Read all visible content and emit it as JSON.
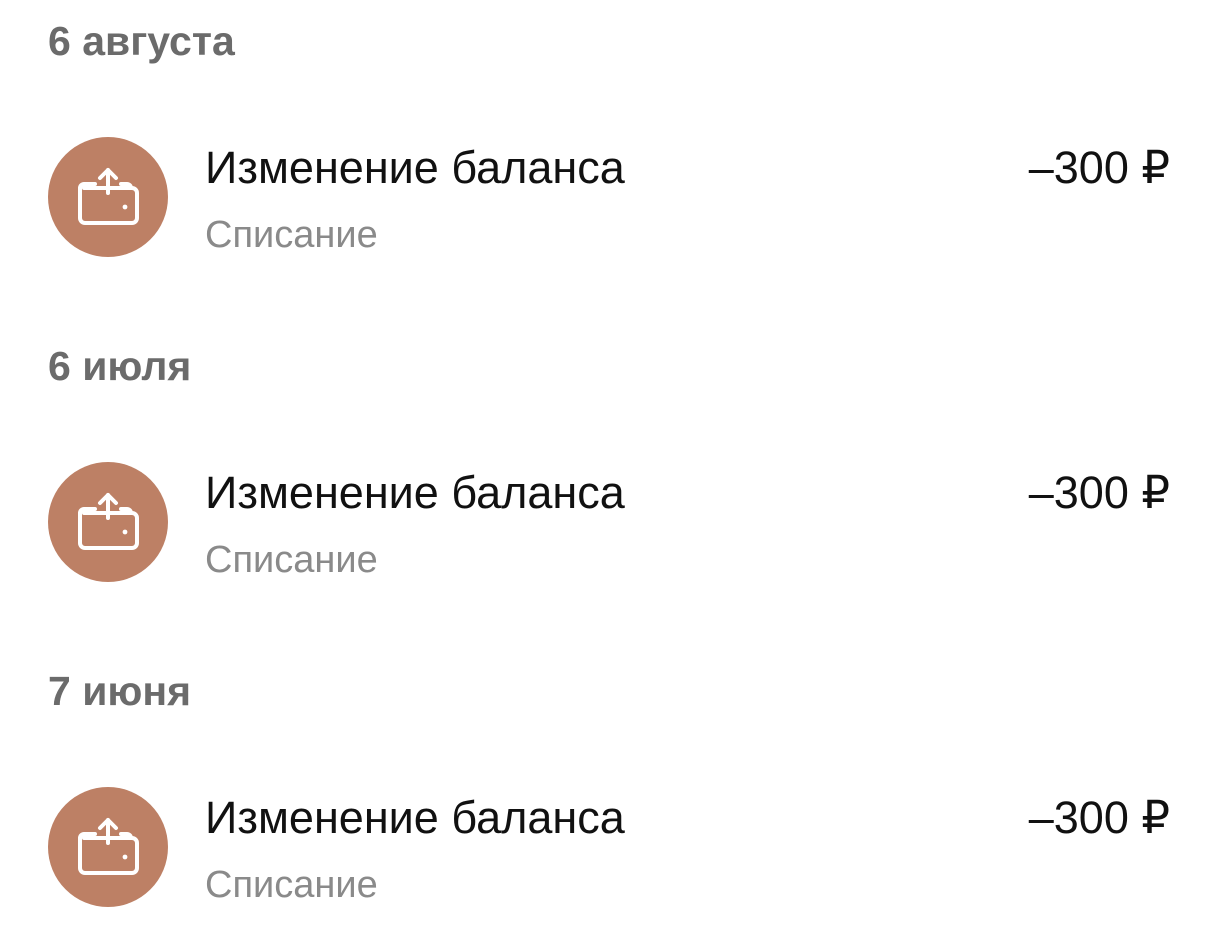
{
  "colors": {
    "icon_background": "#bd8065",
    "icon_glyph": "#ffffff",
    "date_header": "#6b6b6b",
    "title": "#111111",
    "subtitle": "#8a8a8a"
  },
  "groups": [
    {
      "date": "6 августа",
      "transactions": [
        {
          "icon": "wallet-withdraw-icon",
          "title": "Изменение баланса",
          "subtitle": "Списание",
          "amount": "–300 ₽"
        }
      ]
    },
    {
      "date": "6 июля",
      "transactions": [
        {
          "icon": "wallet-withdraw-icon",
          "title": "Изменение баланса",
          "subtitle": "Списание",
          "amount": "–300 ₽"
        }
      ]
    },
    {
      "date": "7 июня",
      "transactions": [
        {
          "icon": "wallet-withdraw-icon",
          "title": "Изменение баланса",
          "subtitle": "Списание",
          "amount": "–300 ₽"
        }
      ]
    }
  ]
}
